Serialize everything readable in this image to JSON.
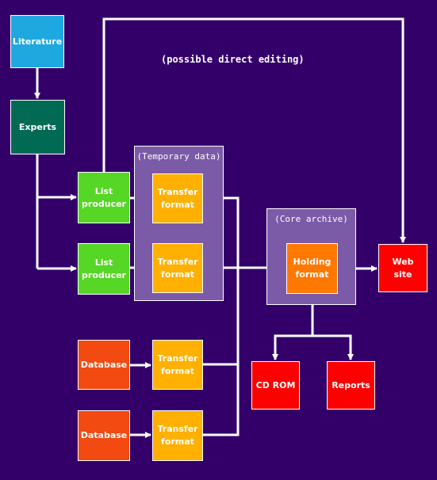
{
  "diagram": {
    "title_note": "(possible direct editing)",
    "colors": {
      "background": "#33006a",
      "literature": "#1fa8e0",
      "experts": "#006a55",
      "list_producer": "#56d625",
      "transfer_format": "#ffb000",
      "database": "#f24a10",
      "holding_format": "#ff7800",
      "output": "#ff0000",
      "container": "#7b5aa8",
      "line": "#ffffff"
    },
    "containers": {
      "temporary": "(Temporary data)",
      "core": "(Core archive)"
    },
    "nodes": {
      "literature": [
        "Literature"
      ],
      "experts": [
        "Experts"
      ],
      "list_producer_1": [
        "List",
        "producer"
      ],
      "list_producer_2": [
        "List",
        "producer"
      ],
      "transfer_1": [
        "Transfer",
        "format"
      ],
      "transfer_2": [
        "Transfer",
        "format"
      ],
      "database_1": [
        "Database"
      ],
      "database_2": [
        "Database"
      ],
      "transfer_3": [
        "Transfer",
        "format"
      ],
      "transfer_4": [
        "Transfer",
        "format"
      ],
      "holding": [
        "Holding",
        "format"
      ],
      "website": [
        "Web",
        "site"
      ],
      "cdrom": [
        "CD ROM"
      ],
      "reports": [
        "Reports"
      ]
    },
    "edges": [
      {
        "from": "literature",
        "to": "experts"
      },
      {
        "from": "experts",
        "to": "list_producer_1"
      },
      {
        "from": "experts",
        "to": "list_producer_2"
      },
      {
        "from": "list_producer_1",
        "to": "transfer_1"
      },
      {
        "from": "list_producer_2",
        "to": "transfer_2"
      },
      {
        "from": "database_1",
        "to": "transfer_3"
      },
      {
        "from": "database_2",
        "to": "transfer_4"
      },
      {
        "from": "transfer_1",
        "to": "holding"
      },
      {
        "from": "transfer_2",
        "to": "holding"
      },
      {
        "from": "transfer_3",
        "to": "holding"
      },
      {
        "from": "transfer_4",
        "to": "holding"
      },
      {
        "from": "holding",
        "to": "website"
      },
      {
        "from": "holding",
        "to": "cdrom"
      },
      {
        "from": "holding",
        "to": "reports"
      },
      {
        "from": "list_producer_1",
        "to": "website",
        "label": "(possible direct editing)"
      }
    ]
  }
}
